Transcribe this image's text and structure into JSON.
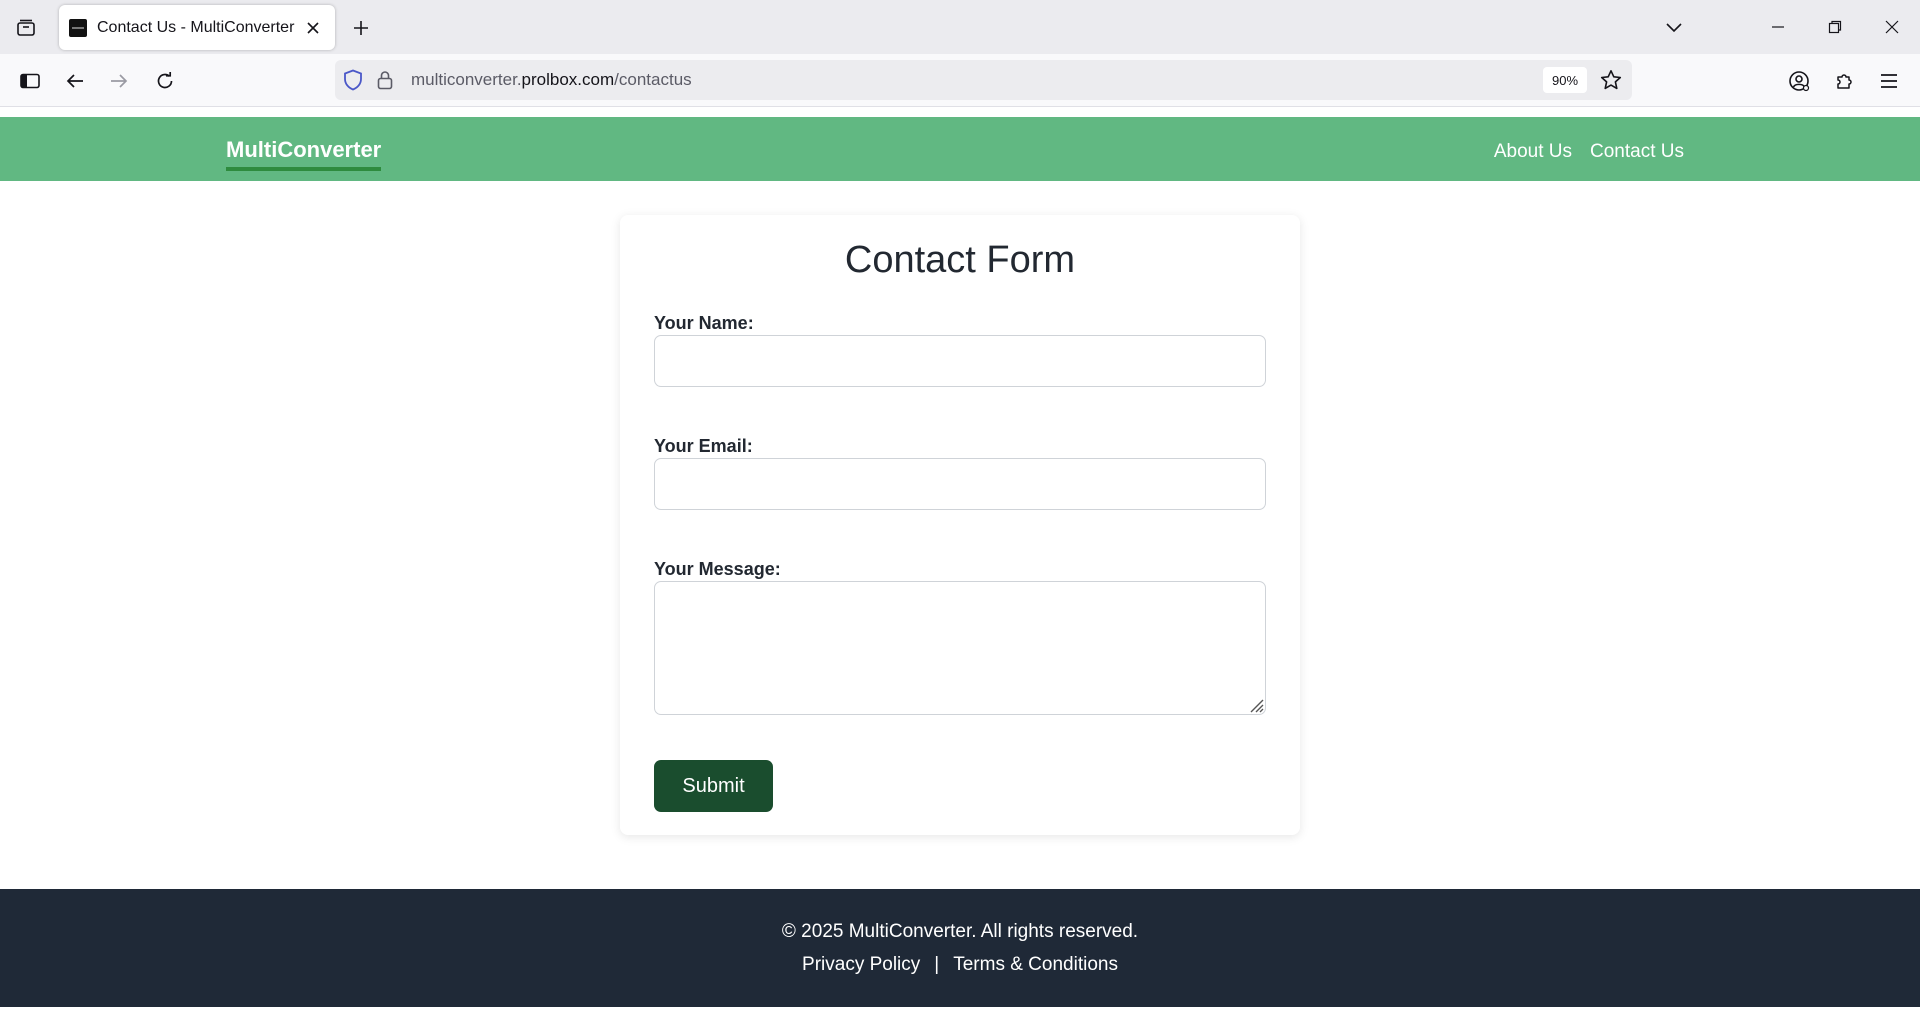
{
  "browser": {
    "tab_title": "Contact Us - MultiConverter",
    "url_prefix": "multiconverter.",
    "url_host": "prolbox.com",
    "url_path": "/contactus",
    "zoom": "90%"
  },
  "site": {
    "brand": "MultiConverter",
    "nav": [
      "About Us",
      "Contact Us"
    ],
    "colors": {
      "header": "#61b882",
      "brand_underline": "#2e8b3e",
      "submit": "#1a4d2e",
      "footer": "#1f2937"
    }
  },
  "form": {
    "title": "Contact Form",
    "name_label": "Your Name:",
    "name_value": "",
    "email_label": "Your Email:",
    "email_value": "",
    "message_label": "Your Message:",
    "message_value": "",
    "submit_label": "Submit"
  },
  "footer": {
    "copyright": "© 2025 MultiConverter. All rights reserved.",
    "privacy": "Privacy Policy",
    "separator": "|",
    "terms": "Terms & Conditions"
  },
  "icons": {
    "tab_list": "tab-list-icon",
    "close": "close-icon",
    "new_tab": "plus-icon",
    "tabs_dropdown": "chevron-down-icon",
    "minimize": "minimize-icon",
    "restore": "restore-icon",
    "window_close": "window-close-icon",
    "sidebar": "sidebar-icon",
    "back": "back-arrow-icon",
    "forward": "forward-arrow-icon",
    "reload": "reload-icon",
    "tracking": "shield-icon",
    "lock": "lock-icon",
    "bookmark": "star-icon",
    "account": "account-icon",
    "extensions": "puzzle-icon",
    "menu": "hamburger-menu-icon"
  }
}
